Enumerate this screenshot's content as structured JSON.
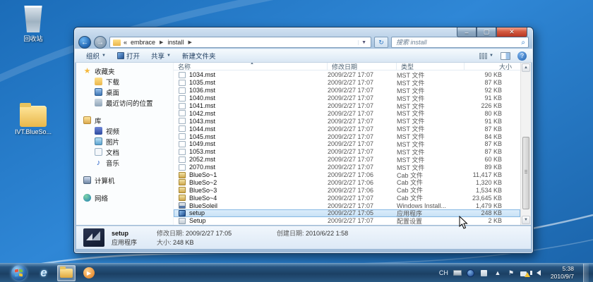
{
  "desktop": {
    "icons": [
      {
        "label": "回收站"
      },
      {
        "label": "IVT.BlueSo..."
      }
    ]
  },
  "window": {
    "address": {
      "breadcrumb_prefix": "«",
      "crumbs": [
        "embrace",
        "install"
      ],
      "search_placeholder": "搜索 install"
    },
    "toolbar": {
      "organize": "组织",
      "open": "打开",
      "share": "共享",
      "new_folder": "新建文件夹"
    },
    "sidebar": {
      "items": [
        {
          "label": "收藏夹",
          "icon": "favorites-star",
          "level": 0,
          "gap": false,
          "glyph": "★"
        },
        {
          "label": "下载",
          "icon": "downloads",
          "level": 1,
          "gap": false,
          "glyph": ""
        },
        {
          "label": "桌面",
          "icon": "desktop",
          "level": 1,
          "gap": false,
          "glyph": ""
        },
        {
          "label": "最近访问的位置",
          "icon": "recent-places",
          "level": 1,
          "gap": false,
          "glyph": ""
        },
        {
          "label": "库",
          "icon": "libraries",
          "level": 0,
          "gap": true,
          "glyph": ""
        },
        {
          "label": "视频",
          "icon": "videos",
          "level": 1,
          "gap": false,
          "glyph": ""
        },
        {
          "label": "图片",
          "icon": "pictures",
          "level": 1,
          "gap": false,
          "glyph": ""
        },
        {
          "label": "文档",
          "icon": "documents",
          "level": 1,
          "gap": false,
          "glyph": ""
        },
        {
          "label": "音乐",
          "icon": "music",
          "level": 1,
          "gap": false,
          "glyph": "♪"
        },
        {
          "label": "计算机",
          "icon": "computer",
          "level": 0,
          "gap": true,
          "glyph": ""
        },
        {
          "label": "网络",
          "icon": "network",
          "level": 0,
          "gap": true,
          "glyph": ""
        }
      ]
    },
    "filelist": {
      "columns": [
        "名称",
        "修改日期",
        "类型",
        "大小"
      ],
      "rows": [
        {
          "name": "1034.mst",
          "date": "2009/2/27 17:07",
          "type": "MST 文件",
          "size": "90 KB",
          "icon": "mst",
          "selected": false
        },
        {
          "name": "1035.mst",
          "date": "2009/2/27 17:07",
          "type": "MST 文件",
          "size": "87 KB",
          "icon": "mst",
          "selected": false
        },
        {
          "name": "1036.mst",
          "date": "2009/2/27 17:07",
          "type": "MST 文件",
          "size": "92 KB",
          "icon": "mst",
          "selected": false
        },
        {
          "name": "1040.mst",
          "date": "2009/2/27 17:07",
          "type": "MST 文件",
          "size": "91 KB",
          "icon": "mst",
          "selected": false
        },
        {
          "name": "1041.mst",
          "date": "2009/2/27 17:07",
          "type": "MST 文件",
          "size": "226 KB",
          "icon": "mst",
          "selected": false
        },
        {
          "name": "1042.mst",
          "date": "2009/2/27 17:07",
          "type": "MST 文件",
          "size": "80 KB",
          "icon": "mst",
          "selected": false
        },
        {
          "name": "1043.mst",
          "date": "2009/2/27 17:07",
          "type": "MST 文件",
          "size": "91 KB",
          "icon": "mst",
          "selected": false
        },
        {
          "name": "1044.mst",
          "date": "2009/2/27 17:07",
          "type": "MST 文件",
          "size": "87 KB",
          "icon": "mst",
          "selected": false
        },
        {
          "name": "1045.mst",
          "date": "2009/2/27 17:07",
          "type": "MST 文件",
          "size": "84 KB",
          "icon": "mst",
          "selected": false
        },
        {
          "name": "1049.mst",
          "date": "2009/2/27 17:07",
          "type": "MST 文件",
          "size": "87 KB",
          "icon": "mst",
          "selected": false
        },
        {
          "name": "1053.mst",
          "date": "2009/2/27 17:07",
          "type": "MST 文件",
          "size": "87 KB",
          "icon": "mst",
          "selected": false
        },
        {
          "name": "2052.mst",
          "date": "2009/2/27 17:07",
          "type": "MST 文件",
          "size": "60 KB",
          "icon": "mst",
          "selected": false
        },
        {
          "name": "2070.mst",
          "date": "2009/2/27 17:07",
          "type": "MST 文件",
          "size": "89 KB",
          "icon": "mst",
          "selected": false
        },
        {
          "name": "BlueSo~1",
          "date": "2009/2/27 17:06",
          "type": "Cab 文件",
          "size": "11,417 KB",
          "icon": "cab",
          "selected": false
        },
        {
          "name": "BlueSo~2",
          "date": "2009/2/27 17:06",
          "type": "Cab 文件",
          "size": "1,320 KB",
          "icon": "cab",
          "selected": false
        },
        {
          "name": "BlueSo~3",
          "date": "2009/2/27 17:06",
          "type": "Cab 文件",
          "size": "1,534 KB",
          "icon": "cab",
          "selected": false
        },
        {
          "name": "BlueSo~4",
          "date": "2009/2/27 17:07",
          "type": "Cab 文件",
          "size": "23,645 KB",
          "icon": "cab",
          "selected": false
        },
        {
          "name": "BlueSoleil",
          "date": "2009/2/27 17:07",
          "type": "Windows Install...",
          "size": "1,479 KB",
          "icon": "msi",
          "selected": false
        },
        {
          "name": "setup",
          "date": "2009/2/27 17:05",
          "type": "应用程序",
          "size": "248 KB",
          "icon": "app",
          "selected": true
        },
        {
          "name": "Setup",
          "date": "2009/2/27 17:07",
          "type": "配置设置",
          "size": "2 KB",
          "icon": "config",
          "selected": false
        }
      ]
    },
    "details": {
      "name": "setup",
      "type": "应用程序",
      "modified_label": "修改日期:",
      "modified_value": "2009/2/27 17:05",
      "created_label": "创建日期:",
      "created_value": "2010/6/22 1:58",
      "size_label": "大小:",
      "size_value": "248 KB"
    }
  },
  "taskbar": {
    "tray": {
      "lang": "CH",
      "time": "5:38",
      "date": "2010/9/7"
    }
  },
  "colors": {
    "accent_selection": "#c6e0f5",
    "taskbar_glass": "#1c4064",
    "desktop_blue": "#2f87d6",
    "close_button_red": "#d25940"
  }
}
